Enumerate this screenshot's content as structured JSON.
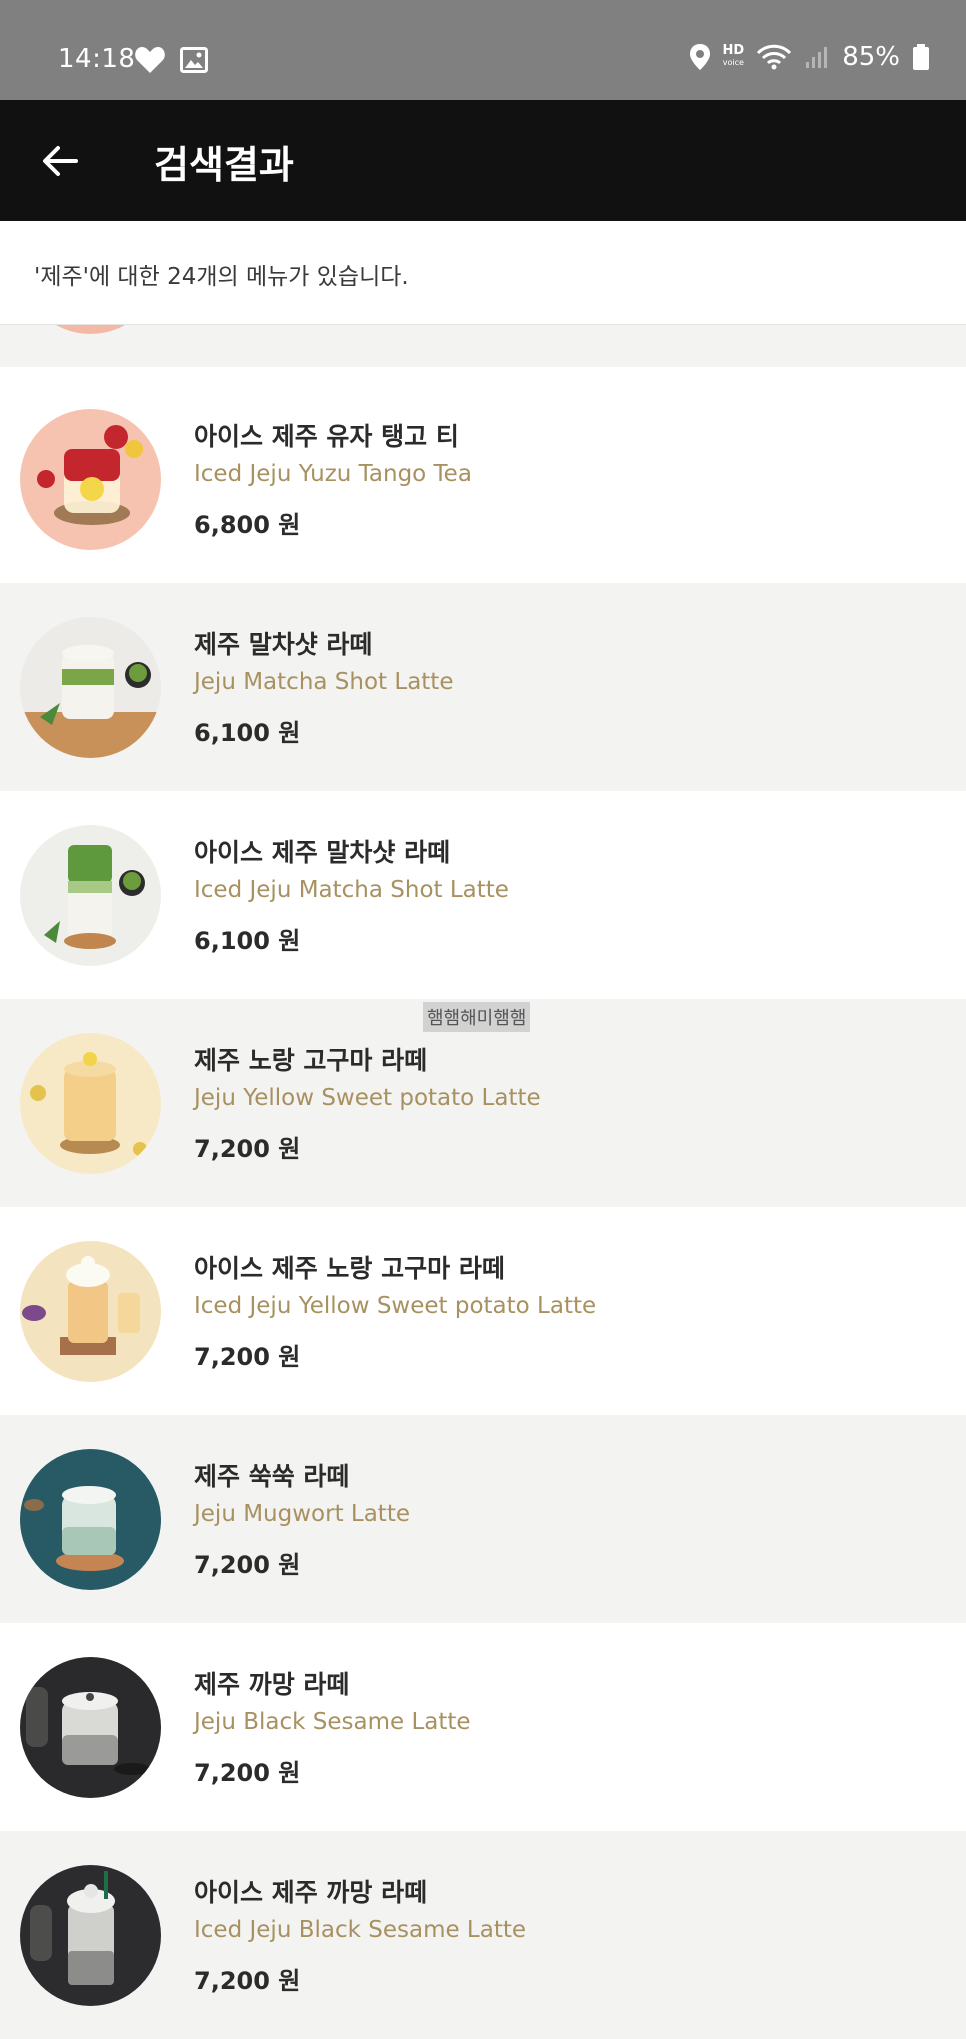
{
  "status_bar": {
    "time": "14:18",
    "battery": "85%",
    "hd_label": "HD",
    "hd_sub": "voice"
  },
  "header": {
    "title": "검색결과"
  },
  "result_summary": "'제주'에 대한 24개의 메뉴가 있습니다.",
  "overlay_label": "햄햄해미햄햄",
  "menu_items": [
    {
      "name_ko": "",
      "name_en": "",
      "price": ""
    },
    {
      "name_ko": "아이스 제주 유자 탱고 티",
      "name_en": "Iced Jeju Yuzu Tango Tea",
      "price": "6,800 원"
    },
    {
      "name_ko": "제주 말차샷 라떼",
      "name_en": "Jeju Matcha Shot Latte",
      "price": "6,100 원"
    },
    {
      "name_ko": "아이스 제주 말차샷 라떼",
      "name_en": "Iced Jeju Matcha Shot Latte",
      "price": "6,100 원"
    },
    {
      "name_ko": "제주 노랑 고구마 라떼",
      "name_en": "Jeju Yellow Sweet potato Latte",
      "price": "7,200 원"
    },
    {
      "name_ko": "아이스 제주 노랑 고구마 라떼",
      "name_en": "Iced Jeju Yellow Sweet potato Latte",
      "price": "7,200 원"
    },
    {
      "name_ko": "제주 쑥쑥 라떼",
      "name_en": "Jeju Mugwort Latte",
      "price": "7,200 원"
    },
    {
      "name_ko": "제주 까망 라떼",
      "name_en": "Jeju Black Sesame Latte",
      "price": "7,200 원"
    },
    {
      "name_ko": "아이스 제주 까망 라떼",
      "name_en": "Iced Jeju Black Sesame Latte",
      "price": "7,200 원"
    }
  ],
  "colors": {
    "status_bar": "#808080",
    "app_bar": "#111111",
    "english_name": "#a89160",
    "row_gray": "#f3f3f1"
  },
  "icons": [
    "heart-icon",
    "image-icon",
    "location-icon",
    "wifi-icon",
    "signal-icon",
    "battery-icon",
    "back-arrow-icon"
  ]
}
